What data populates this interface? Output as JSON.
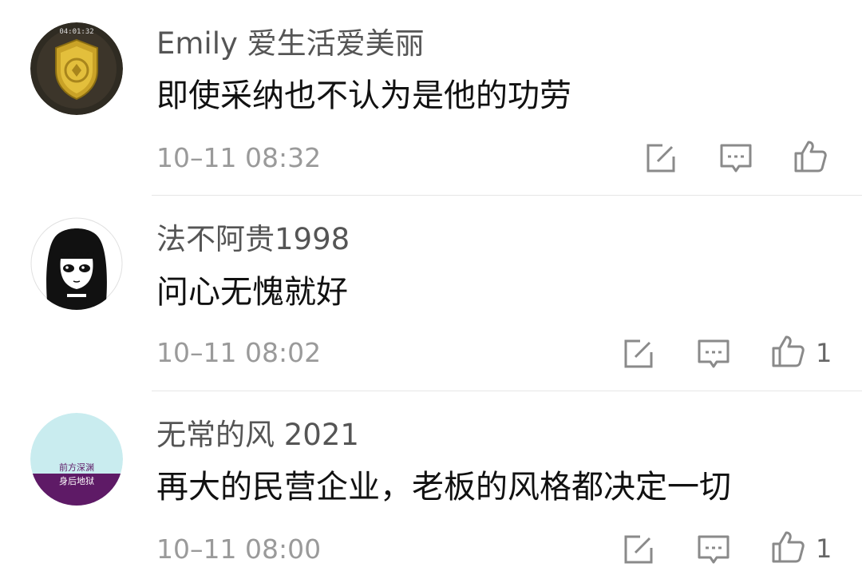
{
  "comments": [
    {
      "username": "Emily 爱生活爱美丽",
      "text": "即使采纳也不认为是他的功劳",
      "timestamp": "10–11 08:32",
      "likes": "",
      "avatar": {
        "icon": "shield-icon",
        "badge_text": "04:01:32"
      }
    },
    {
      "username": "法不阿贵1998",
      "text": "问心无愧就好",
      "timestamp": "10–11 08:02",
      "likes": "1",
      "avatar": {
        "icon": "anime-girl-avatar"
      }
    },
    {
      "username": "无常的风 2021",
      "text": "再大的民营企业，老板的风格都决定一切",
      "timestamp": "10–11 08:00",
      "likes": "1",
      "avatar": {
        "icon": "text-avatar",
        "line1": "前方深渊",
        "line2": "身后地狱"
      }
    }
  ],
  "icons": {
    "edit": "edit-icon",
    "reply": "comment-icon",
    "like": "thumbs-up-icon"
  },
  "colors": {
    "username": "#555555",
    "text": "#111111",
    "meta": "#9a9a9a",
    "icon": "#8a8a8a",
    "divider": "#e6e6e6"
  }
}
